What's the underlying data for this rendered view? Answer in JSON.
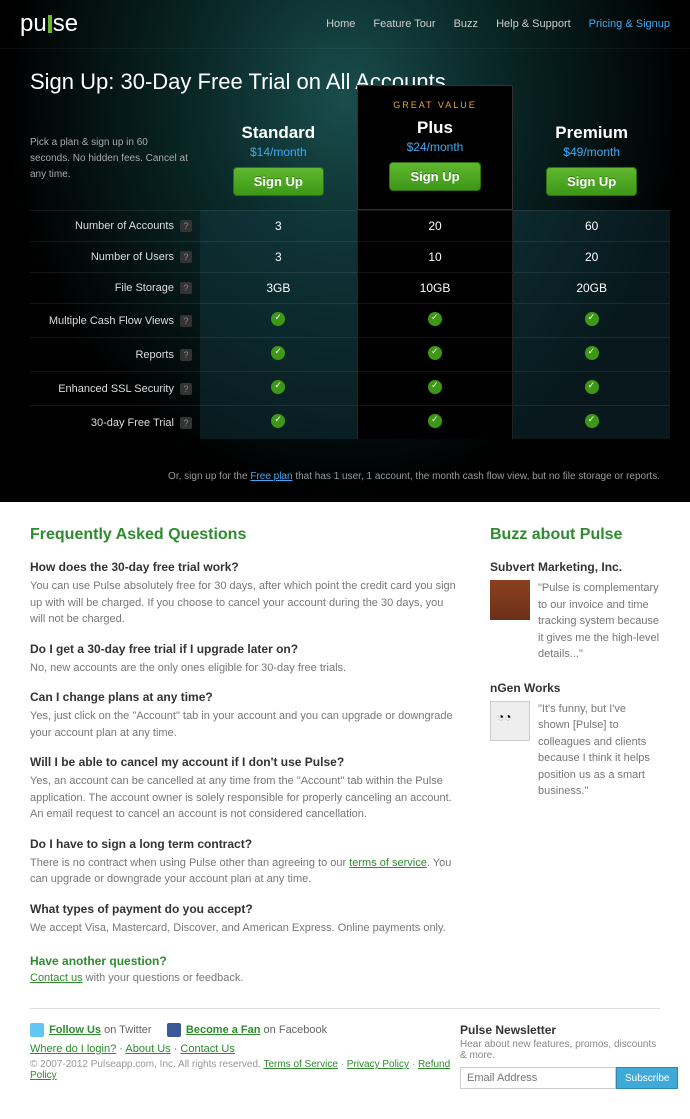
{
  "brand": "pulse",
  "nav": {
    "items": [
      "Home",
      "Feature Tour",
      "Buzz",
      "Help & Support",
      "Pricing & Signup"
    ],
    "active_index": 4
  },
  "hero": {
    "title": "Sign Up: 30-Day Free Trial on All Accounts"
  },
  "pick_text": "Pick a plan & sign up in 60 seconds. No hidden fees. Cancel at any time.",
  "plans": [
    {
      "name": "Standard",
      "price": "$14/month",
      "signup": "Sign Up",
      "badge": ""
    },
    {
      "name": "Plus",
      "price": "$24/month",
      "signup": "Sign Up",
      "badge": "GREAT VALUE"
    },
    {
      "name": "Premium",
      "price": "$49/month",
      "signup": "Sign Up",
      "badge": ""
    }
  ],
  "feature_rows": [
    {
      "label": "Number of Accounts",
      "values": [
        "3",
        "20",
        "60"
      ],
      "help": true
    },
    {
      "label": "Number of Users",
      "values": [
        "3",
        "10",
        "20"
      ],
      "help": true
    },
    {
      "label": "File Storage",
      "values": [
        "3GB",
        "10GB",
        "20GB"
      ],
      "help": true
    },
    {
      "label": "Multiple Cash Flow Views",
      "values": [
        "check",
        "check",
        "check"
      ],
      "help": true
    },
    {
      "label": "Reports",
      "values": [
        "check",
        "check",
        "check"
      ],
      "help": true
    },
    {
      "label": "Enhanced SSL Security",
      "values": [
        "check",
        "check",
        "check"
      ],
      "help": true
    },
    {
      "label": "30-day Free Trial",
      "values": [
        "check",
        "check",
        "check"
      ],
      "help": true
    }
  ],
  "free_note": {
    "prefix": "Or, sign up for the ",
    "link": "Free plan",
    "suffix": " that has 1 user, 1 account, the month cash flow view, but no file storage or reports."
  },
  "faq": {
    "heading": "Frequently Asked Questions",
    "items": [
      {
        "q": "How does the 30-day free trial work?",
        "a": "You can use Pulse absolutely free for 30 days, after which point the credit card you sign up with will be charged. If you choose to cancel your account during the 30 days, you will not be charged."
      },
      {
        "q": "Do I get a 30-day free trial if I upgrade later on?",
        "a": "No, new accounts are the only ones eligible for 30-day free trials."
      },
      {
        "q": "Can I change plans at any time?",
        "a": "Yes, just click on the \"Account\" tab in your account and you can upgrade or downgrade your account plan at any time."
      },
      {
        "q": "Will I be able to cancel my account if I don't use Pulse?",
        "a": "Yes, an account can be cancelled at any time from the \"Account\" tab within the Pulse application. The account owner is solely responsible for properly canceling an account. An email request to cancel an account is not considered cancellation."
      },
      {
        "q": "Do I have to sign a long term contract?",
        "a_before": "There is no contract when using Pulse other than agreeing to our ",
        "a_link": "terms of service",
        "a_after": ". You can upgrade or downgrade your account plan at any time."
      },
      {
        "q": "What types of payment do you accept?",
        "a": "We accept Visa, Mastercard, Discover, and American Express. Online payments only."
      }
    ],
    "another": "Have another question?",
    "contact_link": "Contact us",
    "contact_rest": " with your questions or feedback."
  },
  "buzz": {
    "heading": "Buzz about Pulse",
    "items": [
      {
        "name": "Subvert Marketing, Inc.",
        "quote": "\"Pulse is complementary to our invoice and time tracking system because it gives me the high-level details...\""
      },
      {
        "name": "nGen Works",
        "quote": "\"It's funny, but I've shown [Pulse] to colleagues and clients because I think it helps position us as a smart business.\""
      }
    ]
  },
  "footer": {
    "follow": "Follow Us",
    "follow_suffix": " on Twitter",
    "fan": "Become a Fan",
    "fan_suffix": " on Facebook",
    "links": [
      "Where do I login?",
      "About Us",
      "Contact Us"
    ],
    "copyright": "© 2007-2012 Pulseapp.com, Inc. All rights reserved. ",
    "legal": [
      "Terms of Service",
      "Privacy Policy",
      "Refund Policy"
    ],
    "newsletter": {
      "title": "Pulse Newsletter",
      "sub": "Hear about new features, promos, discounts & more.",
      "placeholder": "Email Address",
      "button": "Subscribe"
    }
  }
}
